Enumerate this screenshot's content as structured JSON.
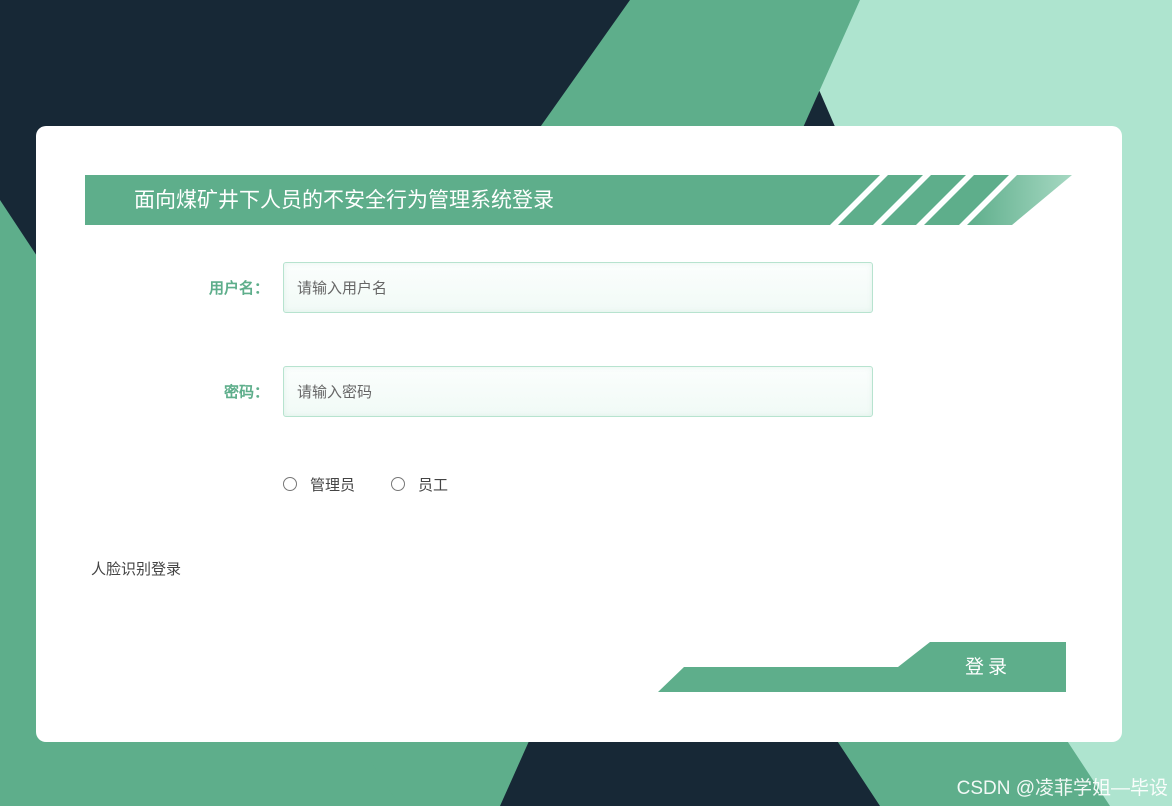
{
  "page": {
    "title": "面向煤矿井下人员的不安全行为管理系统登录"
  },
  "form": {
    "username": {
      "label": "用户名：",
      "placeholder": "请输入用户名",
      "value": ""
    },
    "password": {
      "label": "密码：",
      "placeholder": "请输入密码",
      "value": ""
    },
    "roles": [
      {
        "label": "管理员",
        "checked": false
      },
      {
        "label": "员工",
        "checked": false
      }
    ],
    "face_login_label": "人脸识别登录",
    "submit_label": "登录"
  },
  "watermark": "CSDN @凌菲学姐—毕设",
  "colors": {
    "accent": "#5eae8b",
    "light_accent": "#aee4cf",
    "dark_bg": "#172836",
    "card": "#ffffff"
  }
}
